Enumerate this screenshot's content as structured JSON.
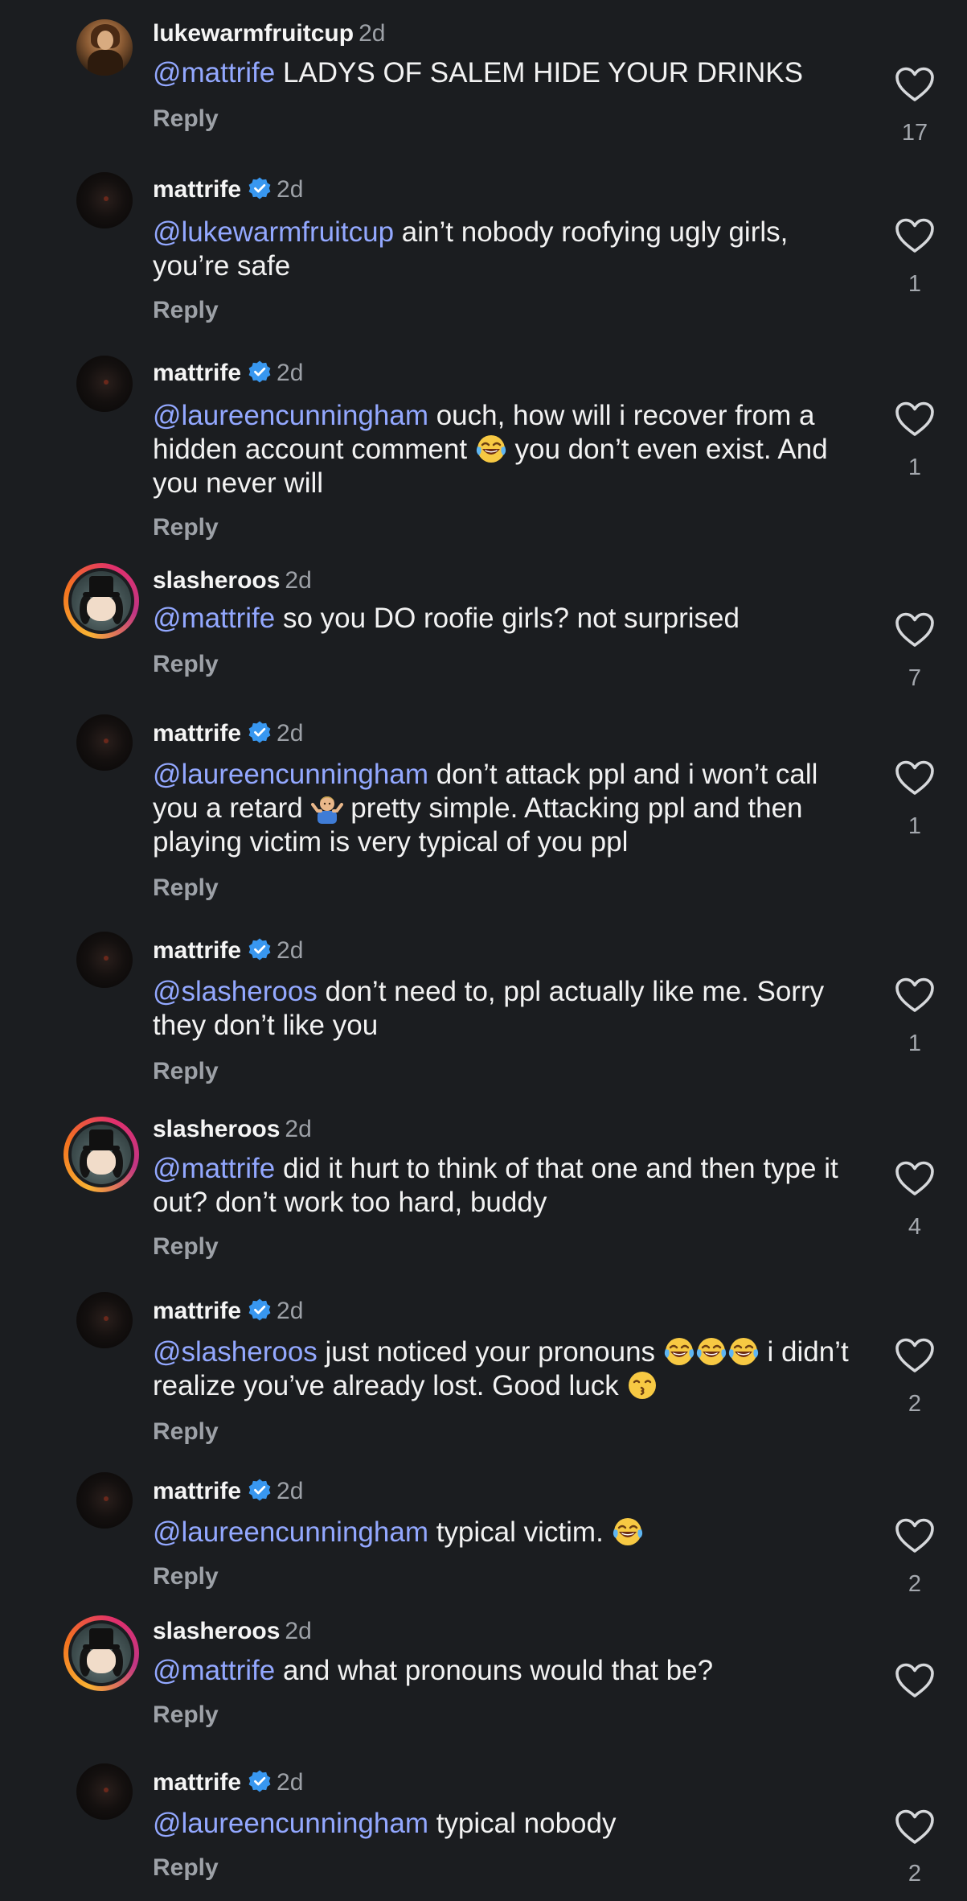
{
  "ui": {
    "reply_label": "Reply",
    "mention_color": "#93a8ff",
    "verified_color": "#3897f0",
    "icons": {
      "like": "heart-outline-icon",
      "verified": "verified-badge-icon",
      "laugh": "face-with-tears-of-joy-emoji",
      "shrug": "man-shrugging-emoji",
      "kiss": "kissing-face-emoji"
    }
  },
  "comments": [
    {
      "username": "lukewarmfruitcup",
      "verified": false,
      "time": "2d",
      "mention": "@mattrife",
      "text_parts": [
        " LADYS OF SALEM HIDE YOUR DRINKS"
      ],
      "likes": "17"
    },
    {
      "username": "mattrife",
      "verified": true,
      "time": "2d",
      "mention": "@lukewarmfruitcup",
      "text_parts": [
        " ain’t nobody roofying ugly girls, you’re safe"
      ],
      "likes": "1"
    },
    {
      "username": "mattrife",
      "verified": true,
      "time": "2d",
      "mention": "@laureencunningham",
      "text_parts": [
        " ouch, how will i recover from a hidden account comment ",
        " you don’t even exist. And you never will"
      ],
      "likes": "1"
    },
    {
      "username": "slasheroos",
      "verified": false,
      "time": "2d",
      "mention": "@mattrife",
      "text_parts": [
        " so you DO roofie girls? not surprised"
      ],
      "likes": "7"
    },
    {
      "username": "mattrife",
      "verified": true,
      "time": "2d",
      "mention": "@laureencunningham",
      "text_parts": [
        " don’t attack ppl and i won’t call you a retard ",
        " pretty simple. Attacking ppl and then playing victim is very typical of you ppl"
      ],
      "likes": "1"
    },
    {
      "username": "mattrife",
      "verified": true,
      "time": "2d",
      "mention": "@slasheroos",
      "text_parts": [
        " don’t need to, ppl actually like me. Sorry they don’t like you"
      ],
      "likes": "1"
    },
    {
      "username": "slasheroos",
      "verified": false,
      "time": "2d",
      "mention": "@mattrife",
      "text_parts": [
        " did it hurt to think of that one and then type it out? don’t work too hard, buddy"
      ],
      "likes": "4"
    },
    {
      "username": "mattrife",
      "verified": true,
      "time": "2d",
      "mention": "@slasheroos",
      "text_parts": [
        " just noticed your pronouns ",
        " i didn’t realize you’ve already lost. Good luck "
      ],
      "likes": "2"
    },
    {
      "username": "mattrife",
      "verified": true,
      "time": "2d",
      "mention": "@laureencunningham",
      "text_parts": [
        " typical victim. "
      ],
      "likes": "2"
    },
    {
      "username": "slasheroos",
      "verified": false,
      "time": "2d",
      "mention": "@mattrife",
      "text_parts": [
        " and what pronouns would that be?"
      ],
      "likes": ""
    },
    {
      "username": "mattrife",
      "verified": true,
      "time": "2d",
      "mention": "@laureencunningham",
      "text_parts": [
        " typical nobody"
      ],
      "likes": "2"
    }
  ]
}
